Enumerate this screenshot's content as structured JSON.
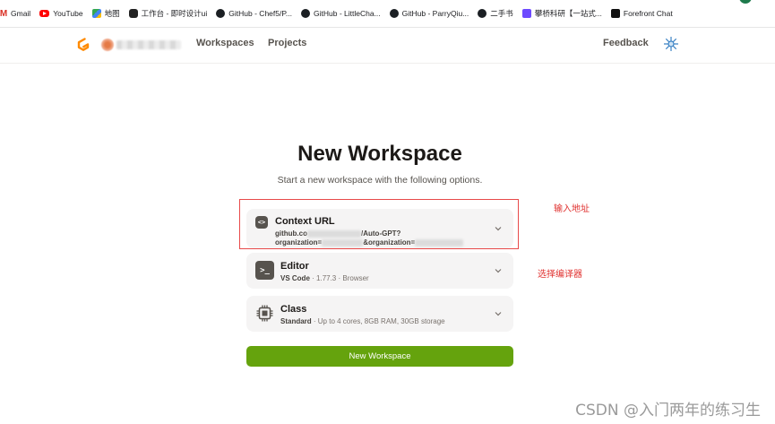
{
  "bookmarks": [
    {
      "label": "Gmail",
      "icon": "gmail-icon"
    },
    {
      "label": "YouTube",
      "icon": "youtube-icon"
    },
    {
      "label": "地图",
      "icon": "maps-icon"
    },
    {
      "label": "工作台 - 即时设计ui",
      "icon": "workbench-icon"
    },
    {
      "label": "GitHub - Chef5/P...",
      "icon": "github-icon"
    },
    {
      "label": "GitHub - LittleCha...",
      "icon": "github-icon"
    },
    {
      "label": "GitHub - ParryQiu...",
      "icon": "github-icon"
    },
    {
      "label": "二手书",
      "icon": "github-icon"
    },
    {
      "label": "攀桥科研【一站式...",
      "icon": "gk-icon"
    },
    {
      "label": "Forefront Chat",
      "icon": "forefront-icon"
    }
  ],
  "header": {
    "nav": {
      "workspaces": "Workspaces",
      "projects": "Projects"
    },
    "feedback": "Feedback"
  },
  "main": {
    "title": "New Workspace",
    "subtitle": "Start a new workspace with the following options.",
    "context": {
      "label": "Context URL",
      "url_line1_start": "github.co",
      "url_line1_end": "/Auto-GPT?",
      "url_line2_start": "organization=",
      "url_line2_mid": "&organization="
    },
    "editor": {
      "label": "Editor",
      "name": "VS Code",
      "detail": " · 1.77.3 · Browser"
    },
    "workspace_class": {
      "label": "Class",
      "name": "Standard",
      "detail": " · Up to 4 cores, 8GB RAM, 30GB storage"
    },
    "create_button": "New Workspace"
  },
  "annotations": {
    "url": "输入地址",
    "editor": "选择编译器"
  },
  "watermark": "CSDN @入门两年的练习生",
  "colors": {
    "primary_button": "#65a30d",
    "annotation": "#e0312f",
    "logo": "#ff8a00"
  }
}
